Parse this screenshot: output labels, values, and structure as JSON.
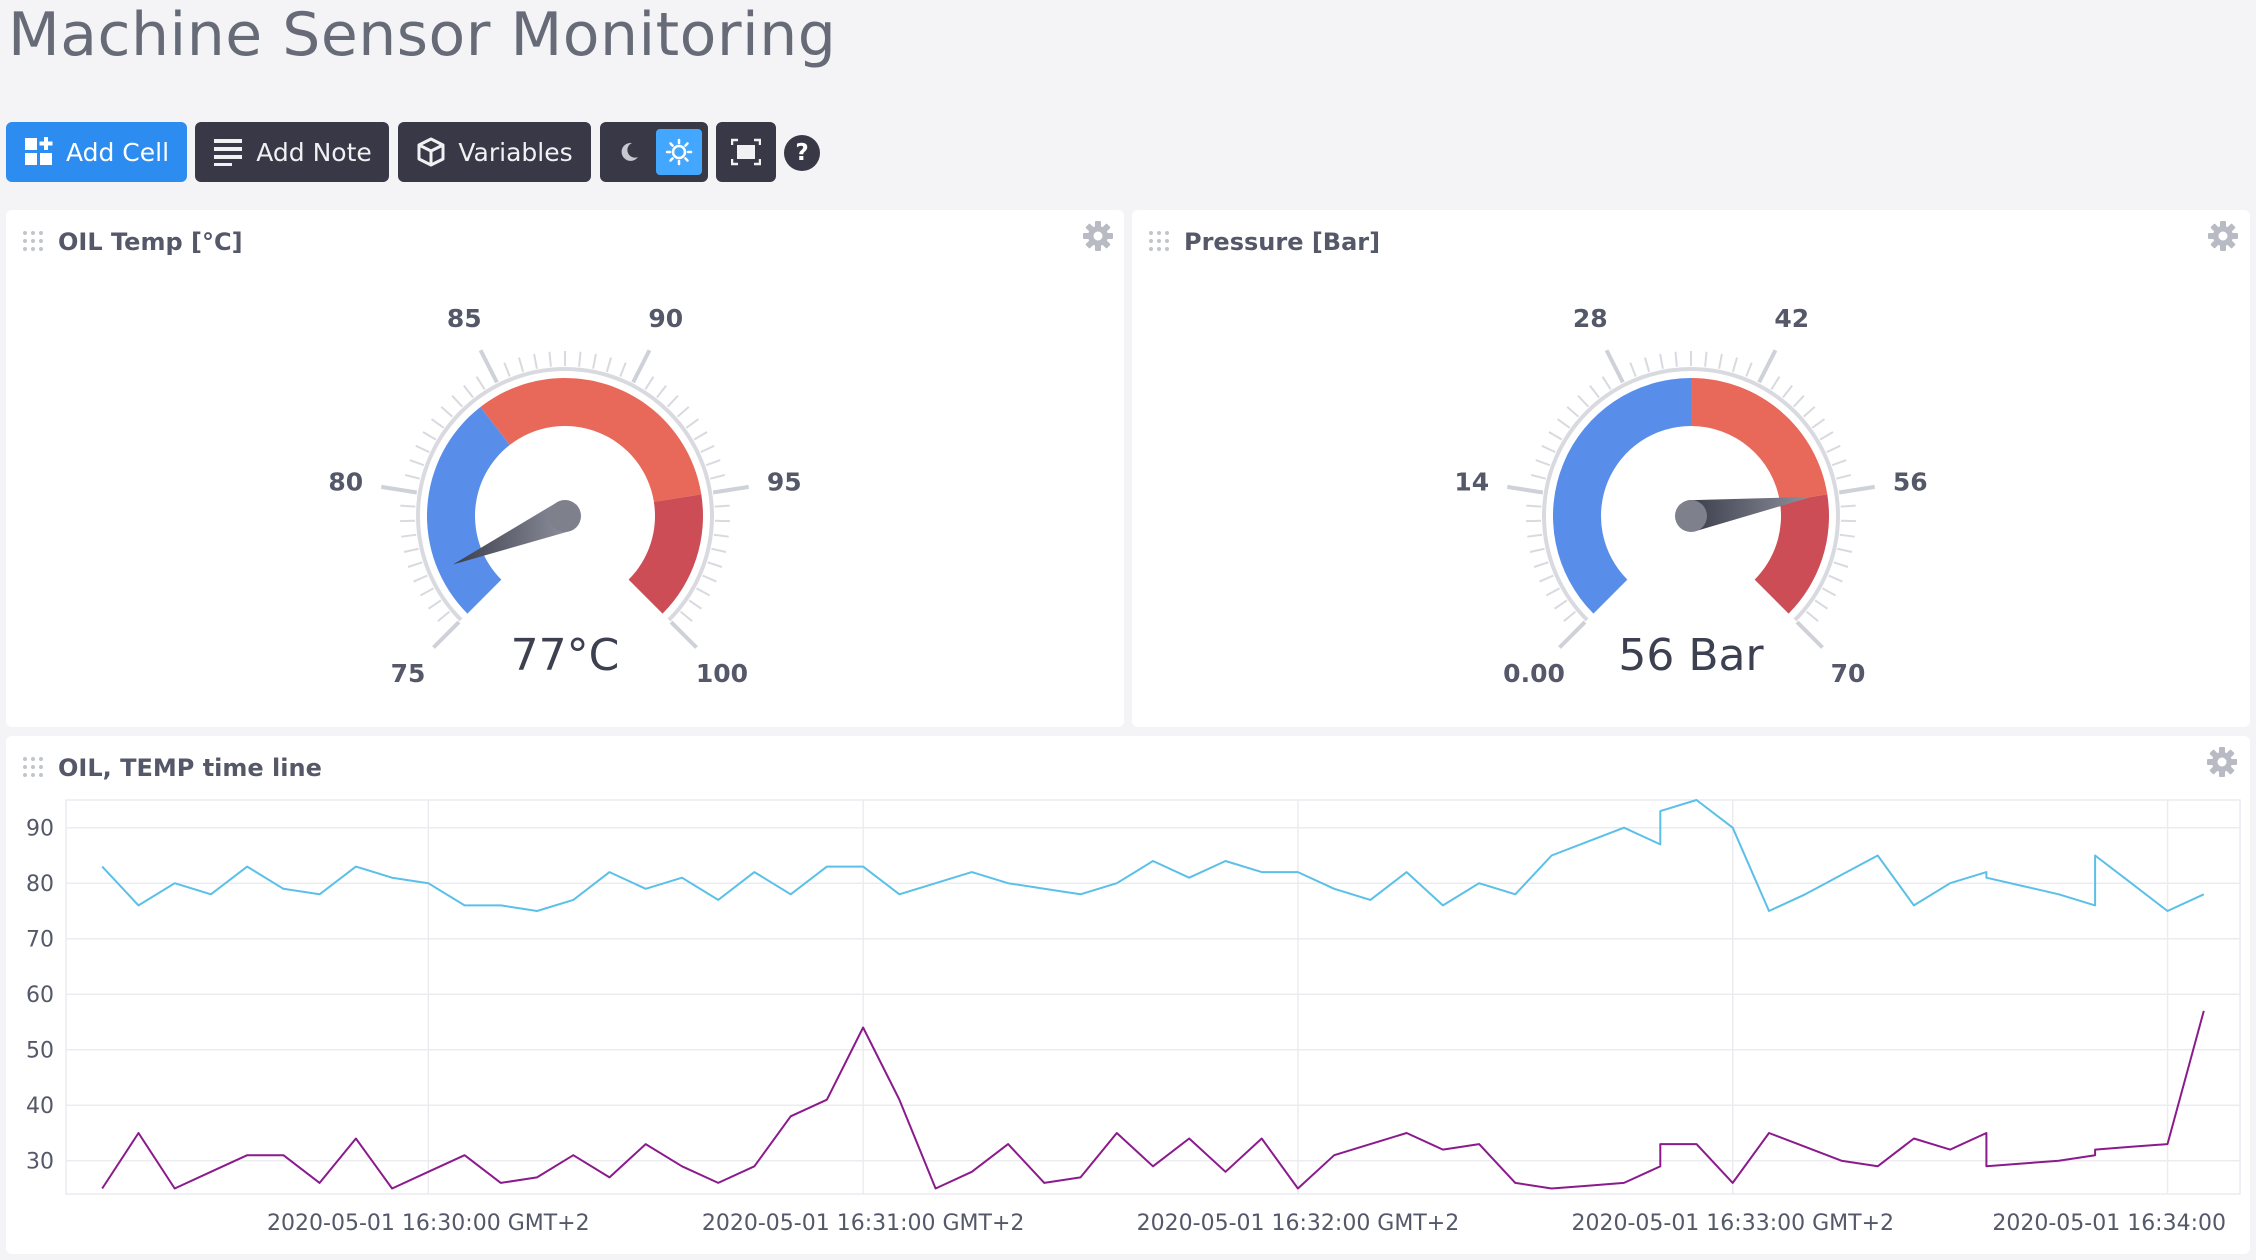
{
  "header": {
    "title": "Machine Sensor Monitoring"
  },
  "toolbar": {
    "add_cell_label": "Add Cell",
    "add_note_label": "Add Note",
    "variables_label": "Variables",
    "help_label": "?"
  },
  "colors": {
    "accent": "#2c8cf0",
    "gauge_blue": "#588eea",
    "gauge_red": "#e8695a",
    "gauge_dark_red": "#cc4d55",
    "oil_line": "#5bc0e8",
    "temp_line": "#8b1a8c"
  },
  "cells": {
    "oil_temp": {
      "title": "OIL Temp [°C]",
      "value_text": "77°C",
      "ticks": [
        "75",
        "80",
        "85",
        "90",
        "95",
        "100"
      ]
    },
    "pressure": {
      "title": "Pressure [Bar]",
      "value_text": "56 Bar",
      "ticks": [
        "0.00",
        "14",
        "28",
        "42",
        "56",
        "70"
      ]
    },
    "timeline": {
      "title": "OIL, TEMP time line"
    }
  },
  "chart_data": [
    {
      "type": "gauge",
      "title": "OIL Temp [°C]",
      "min": 75,
      "max": 100,
      "value": 77,
      "unit": "°C",
      "segments": [
        {
          "from": 75,
          "to": 84,
          "color": "#588eea"
        },
        {
          "from": 84,
          "to": 95,
          "color": "#e8695a"
        },
        {
          "from": 95,
          "to": 100,
          "color": "#cc4d55"
        }
      ]
    },
    {
      "type": "gauge",
      "title": "Pressure [Bar]",
      "min": 0,
      "max": 70,
      "value": 56,
      "unit": "Bar",
      "segments": [
        {
          "from": 0,
          "to": 35,
          "color": "#588eea"
        },
        {
          "from": 35,
          "to": 56,
          "color": "#e8695a"
        },
        {
          "from": 56,
          "to": 70,
          "color": "#cc4d55"
        }
      ]
    },
    {
      "type": "line",
      "title": "OIL, TEMP time line",
      "xlabel": "",
      "ylabel": "",
      "ylim": [
        24,
        95
      ],
      "yticks": [
        30,
        40,
        50,
        60,
        70,
        80,
        90
      ],
      "x_ticks": [
        {
          "t": 0,
          "label": "2020-05-01 16:30:00 GMT+2"
        },
        {
          "t": 60,
          "label": "2020-05-01 16:31:00 GMT+2"
        },
        {
          "t": 120,
          "label": "2020-05-01 16:32:00 GMT+2"
        },
        {
          "t": 180,
          "label": "2020-05-01 16:33:00 GMT+2"
        },
        {
          "t": 240,
          "label": "2020-05-01 16:34:00"
        }
      ],
      "xlim": [
        -50,
        250
      ],
      "series": [
        {
          "color": "#5bc0e8",
          "points": [
            [
              -45,
              83
            ],
            [
              -40,
              76
            ],
            [
              -35,
              80
            ],
            [
              -30,
              78
            ],
            [
              -25,
              83
            ],
            [
              -20,
              79
            ],
            [
              -15,
              78
            ],
            [
              -10,
              83
            ],
            [
              -5,
              81
            ],
            [
              0,
              80
            ],
            [
              5,
              76
            ],
            [
              10,
              76
            ],
            [
              15,
              75
            ],
            [
              20,
              77
            ],
            [
              25,
              82
            ],
            [
              30,
              79
            ],
            [
              35,
              81
            ],
            [
              40,
              77
            ],
            [
              45,
              82
            ],
            [
              50,
              78
            ],
            [
              55,
              83
            ],
            [
              60,
              83
            ],
            [
              65,
              78
            ],
            [
              70,
              80
            ],
            [
              75,
              82
            ],
            [
              80,
              80
            ],
            [
              85,
              79
            ],
            [
              90,
              78
            ],
            [
              95,
              80
            ],
            [
              100,
              84
            ],
            [
              105,
              81
            ],
            [
              110,
              84
            ],
            [
              115,
              82
            ],
            [
              120,
              82
            ],
            [
              125,
              79
            ],
            [
              130,
              77
            ],
            [
              135,
              82
            ],
            [
              140,
              76
            ],
            [
              145,
              80
            ],
            [
              150,
              78
            ],
            [
              155,
              85
            ],
            [
              160,
              87.5
            ],
            [
              165,
              90
            ],
            [
              170,
              87
            ],
            [
              170,
              93
            ],
            [
              175,
              95
            ],
            [
              180,
              90
            ],
            [
              185,
              75
            ],
            [
              190,
              78
            ],
            [
              195,
              81.5
            ],
            [
              200,
              85
            ],
            [
              205,
              76
            ],
            [
              210,
              80
            ],
            [
              215,
              82
            ],
            [
              215,
              81
            ],
            [
              220,
              79.5
            ],
            [
              225,
              78
            ],
            [
              230,
              76
            ],
            [
              230,
              85
            ],
            [
              235,
              80
            ],
            [
              240,
              75
            ],
            [
              245,
              78
            ]
          ]
        },
        {
          "color": "#8b1a8c",
          "points": [
            [
              -45,
              25
            ],
            [
              -40,
              35
            ],
            [
              -35,
              25
            ],
            [
              -30,
              28
            ],
            [
              -25,
              31
            ],
            [
              -20,
              31
            ],
            [
              -15,
              26
            ],
            [
              -10,
              34
            ],
            [
              -5,
              25
            ],
            [
              0,
              28
            ],
            [
              5,
              31
            ],
            [
              10,
              26
            ],
            [
              15,
              27
            ],
            [
              20,
              31
            ],
            [
              25,
              27
            ],
            [
              30,
              33
            ],
            [
              35,
              29
            ],
            [
              40,
              26
            ],
            [
              45,
              29
            ],
            [
              50,
              38
            ],
            [
              55,
              41
            ],
            [
              60,
              54
            ],
            [
              65,
              41
            ],
            [
              70,
              25
            ],
            [
              75,
              28
            ],
            [
              80,
              33
            ],
            [
              85,
              26
            ],
            [
              90,
              27
            ],
            [
              95,
              35
            ],
            [
              100,
              29
            ],
            [
              105,
              34
            ],
            [
              110,
              28
            ],
            [
              115,
              34
            ],
            [
              120,
              25
            ],
            [
              125,
              31
            ],
            [
              130,
              33
            ],
            [
              135,
              35
            ],
            [
              140,
              32
            ],
            [
              145,
              33
            ],
            [
              150,
              26
            ],
            [
              155,
              25
            ],
            [
              160,
              25.5
            ],
            [
              165,
              26
            ],
            [
              170,
              29
            ],
            [
              170,
              33
            ],
            [
              175,
              33
            ],
            [
              180,
              26
            ],
            [
              185,
              35
            ],
            [
              190,
              32.5
            ],
            [
              195,
              30
            ],
            [
              200,
              29
            ],
            [
              205,
              34
            ],
            [
              210,
              32
            ],
            [
              215,
              35
            ],
            [
              215,
              29
            ],
            [
              220,
              29.5
            ],
            [
              225,
              30
            ],
            [
              230,
              31
            ],
            [
              230,
              32
            ],
            [
              235,
              32.5
            ],
            [
              240,
              33
            ],
            [
              245,
              57
            ]
          ]
        }
      ]
    }
  ]
}
